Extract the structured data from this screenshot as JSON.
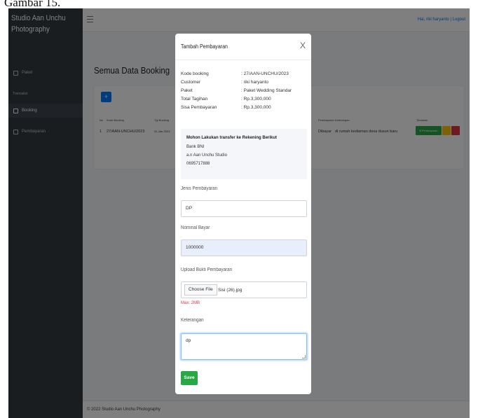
{
  "caption": "Gambar 15.",
  "sidebar": {
    "brand": "Studio Aan Unchu Photography",
    "items": [
      {
        "label": "Paket"
      },
      {
        "label": "Booking"
      },
      {
        "label": "Pembayaran"
      }
    ],
    "section_header": "Transaksi"
  },
  "topbar": {
    "user_text": "Hai, riki haryanto | Logout"
  },
  "page": {
    "title": "Semua Data Booking",
    "add_label": "+",
    "table": {
      "headers": [
        "No",
        "Kode Booking",
        "Tgl Booking",
        "Pembayaran",
        "Keterangan",
        "Tindakan"
      ],
      "row": {
        "no": "1",
        "kode": "27/AAN-UNCHU/2023",
        "tgl": "31-Jan-2023",
        "status": "Dibayar",
        "keterangan": "di rumah kediaman desa dusun baru",
        "pay_label": "$ Pembayaran"
      }
    }
  },
  "footer": {
    "text": "© 2022 Studio Aan Unchu Photography"
  },
  "modal": {
    "title": "Tambah Pembayaran",
    "close": "X",
    "info": [
      {
        "key": "Kode booking",
        "value": ": 27/AAN-UNCHU/2023"
      },
      {
        "key": "Customer",
        "value": ": riki haryanto"
      },
      {
        "key": "Paket",
        "value": ": Paket Wedding Standar"
      },
      {
        "key": "Total Tagihan",
        "value": ": Rp.3,300,000"
      },
      {
        "key": "Sisa Pembayaran",
        "value": ": Rp.3,300,000"
      }
    ],
    "notice": {
      "heading": "Mohon Lakukan transfer ke Rekening Berikut",
      "bank": "Bank BNI",
      "name": "a.n Aan Unchu Studio",
      "number": "0695717888"
    },
    "jenis_label": "Jenis Pembayaran",
    "jenis_value": "DP",
    "nominal_label": "Nominal Bayar",
    "nominal_value": "1000000",
    "upload_label": "Upload Bukti Pembayaran",
    "choose_file": "Choose File",
    "file_name": "Sisi (26).jpg",
    "max_hint": "Max: 2MB",
    "keterangan_label": "Keterangan",
    "keterangan_value": "dp",
    "save_label": "Save"
  }
}
